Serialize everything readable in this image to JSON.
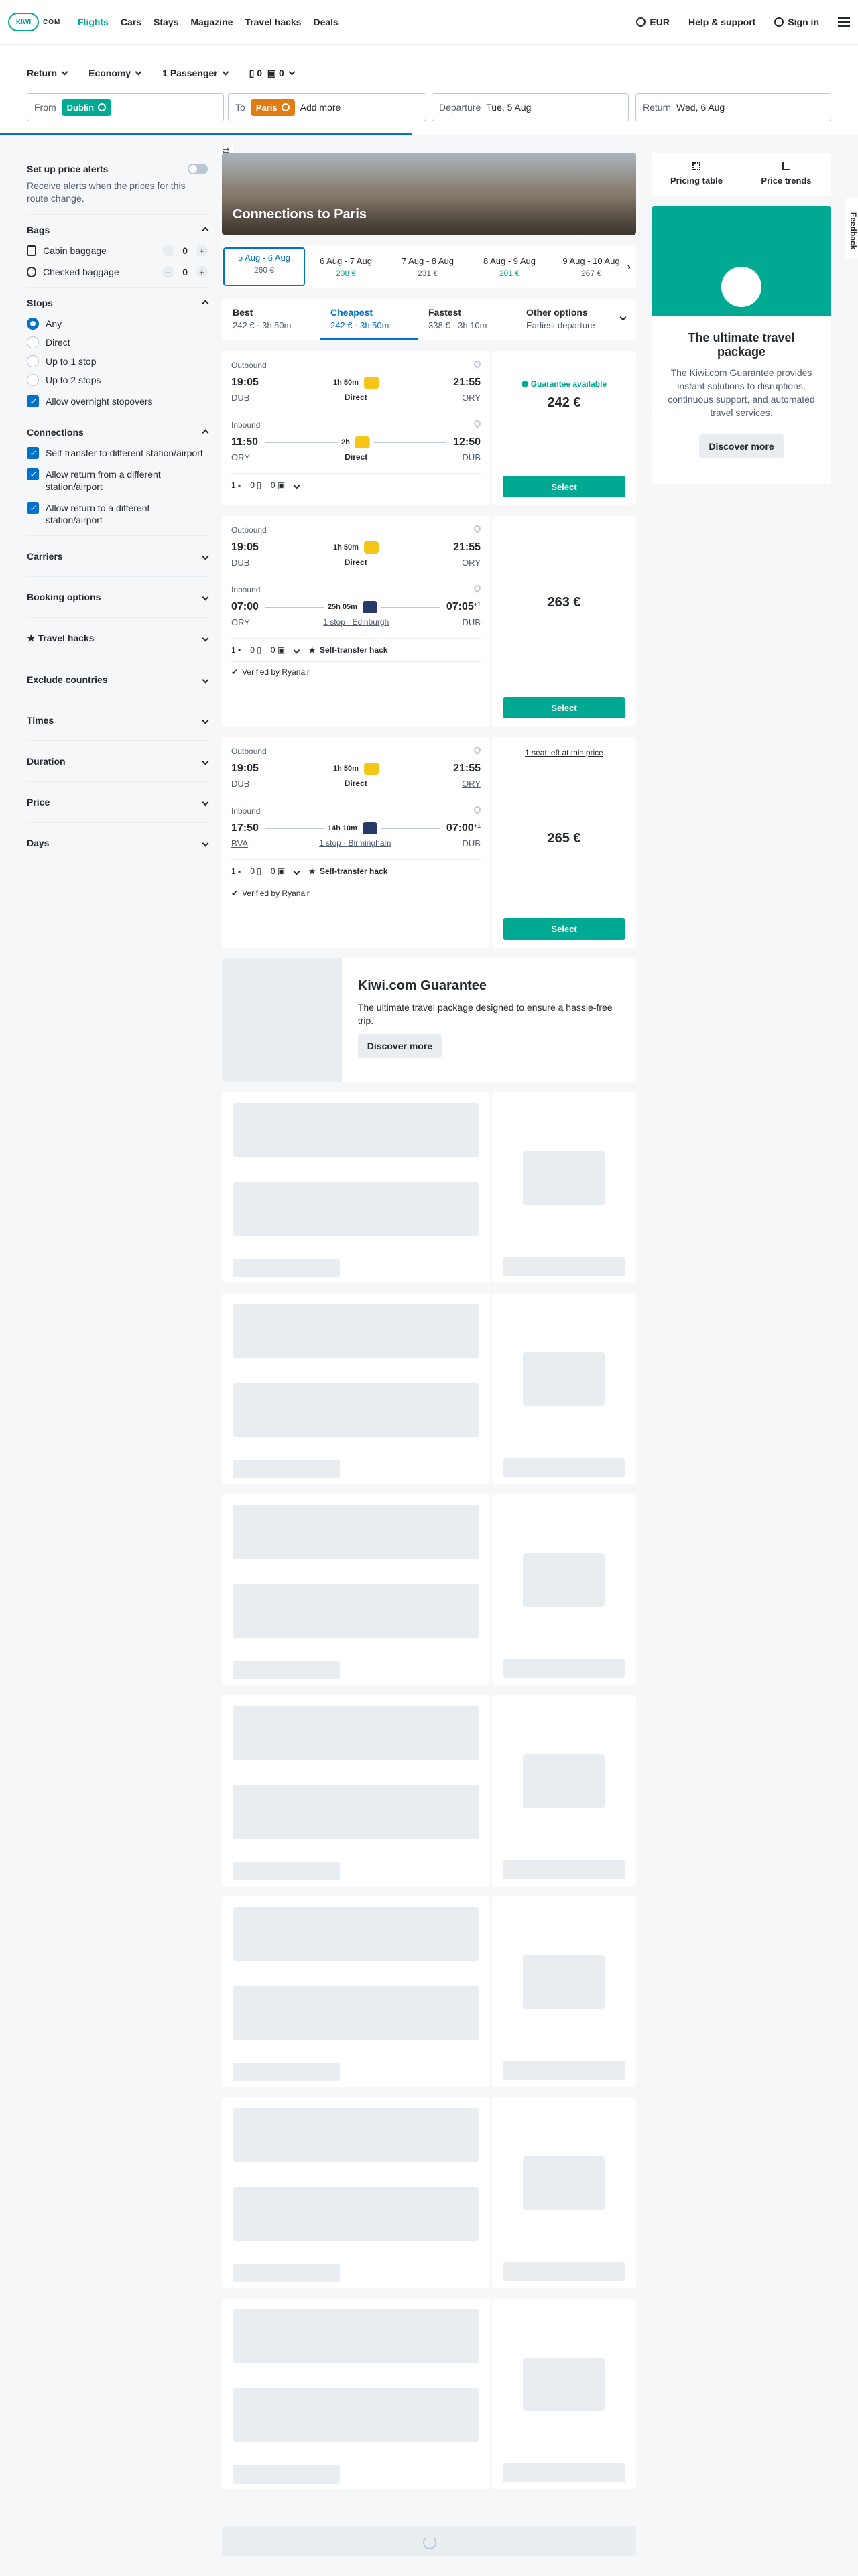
{
  "nav": {
    "logo": "KIWI",
    "logo_suffix": "COM",
    "links": [
      "Flights",
      "Cars",
      "Stays",
      "Magazine",
      "Travel hacks",
      "Deals"
    ],
    "currency": "EUR",
    "help": "Help & support",
    "signin": "Sign in"
  },
  "search": {
    "trip_type": "Return",
    "cabin": "Economy",
    "passengers": "1 Passenger",
    "bags_cabin": "0",
    "bags_checked": "0",
    "from_label": "From",
    "from_value": "Dublin",
    "to_label": "To",
    "to_value": "Paris",
    "add_more": "Add more",
    "departure_label": "Departure",
    "departure_value": "Tue, 5 Aug",
    "return_label": "Return",
    "return_value": "Wed, 6 Aug"
  },
  "sidebar": {
    "alerts_title": "Set up price alerts",
    "alerts_text": "Receive alerts when the prices for this route change.",
    "bags": {
      "title": "Bags",
      "cabin_label": "Cabin baggage",
      "cabin_count": "0",
      "checked_label": "Checked baggage",
      "checked_count": "0"
    },
    "stops": {
      "title": "Stops",
      "options": [
        "Any",
        "Direct",
        "Up to 1 stop",
        "Up to 2 stops"
      ],
      "overnight": "Allow overnight stopovers"
    },
    "connections": {
      "title": "Connections",
      "options": [
        "Self-transfer to different station/airport",
        "Allow return from a different station/airport",
        "Allow return to a different station/airport"
      ]
    },
    "sections": [
      "Carriers",
      "Booking options",
      "Travel hacks",
      "Exclude countries",
      "Times",
      "Duration",
      "Price",
      "Days"
    ]
  },
  "hero_title": "Connections to Paris",
  "dates": [
    {
      "range": "5 Aug - 6 Aug",
      "price": "260 €"
    },
    {
      "range": "6 Aug - 7 Aug",
      "price": "208 €"
    },
    {
      "range": "7 Aug - 8 Aug",
      "price": "231 €"
    },
    {
      "range": "8 Aug - 9 Aug",
      "price": "201 €"
    },
    {
      "range": "9 Aug - 10 Aug",
      "price": "267 €"
    }
  ],
  "sort": [
    {
      "label": "Best",
      "sub": "242 € · 3h 50m"
    },
    {
      "label": "Cheapest",
      "sub": "242 € · 3h 50m"
    },
    {
      "label": "Fastest",
      "sub": "338 € · 3h 10m"
    },
    {
      "label": "Other options",
      "sub": "Earliest departure"
    }
  ],
  "labels": {
    "outbound": "Outbound",
    "inbound": "Inbound",
    "select": "Select",
    "guarantee": "Guarantee available",
    "seat_left": "1 seat left at this price",
    "hack": "Self-transfer hack",
    "verified": "Verified by Ryanair"
  },
  "results": [
    {
      "out": {
        "dep": "19:05",
        "arr": "21:55",
        "dur": "1h 50m",
        "from": "DUB",
        "to": "ORY",
        "stop": "Direct"
      },
      "in": {
        "dep": "11:50",
        "arr": "12:50",
        "dur": "2h",
        "from": "ORY",
        "to": "DUB",
        "stop": "Direct"
      },
      "bags": "1",
      "cabin": "0",
      "checked": "0",
      "price": "242 €"
    },
    {
      "out": {
        "dep": "19:05",
        "arr": "21:55",
        "dur": "1h 50m",
        "from": "DUB",
        "to": "ORY",
        "stop": "Direct"
      },
      "in": {
        "dep": "07:00",
        "arr": "07:05",
        "arr_sup": "+1",
        "dur": "25h 05m",
        "from": "ORY",
        "to": "DUB",
        "stop": "1 stop · Edinburgh"
      },
      "bags": "1",
      "cabin": "0",
      "checked": "0",
      "price": "263 €"
    },
    {
      "out": {
        "dep": "19:05",
        "arr": "21:55",
        "dur": "1h 50m",
        "from": "DUB",
        "to": "ORY",
        "stop": "Direct"
      },
      "in": {
        "dep": "17:50",
        "arr": "07:00",
        "arr_sup": "+1",
        "dur": "14h 10m",
        "from": "BVA",
        "to": "DUB",
        "stop": "1 stop · Birmingham"
      },
      "bags": "1",
      "cabin": "0",
      "checked": "0",
      "price": "265 €"
    }
  ],
  "guarantee": {
    "title": "Kiwi.com Guarantee",
    "text": "The ultimate travel package designed to ensure a hassle-free trip.",
    "button": "Discover more"
  },
  "right": {
    "tab1": "Pricing table",
    "tab2": "Price trends",
    "promo_title": "The ultimate travel package",
    "promo_text": "The Kiwi.com Guarantee provides instant solutions to disruptions, continuous support, and automated travel services.",
    "promo_button": "Discover more",
    "feedback": "Feedback"
  },
  "colors": {
    "brand": "#00a991",
    "accent": "#0172cb",
    "chip_orange": "#e17c12"
  }
}
